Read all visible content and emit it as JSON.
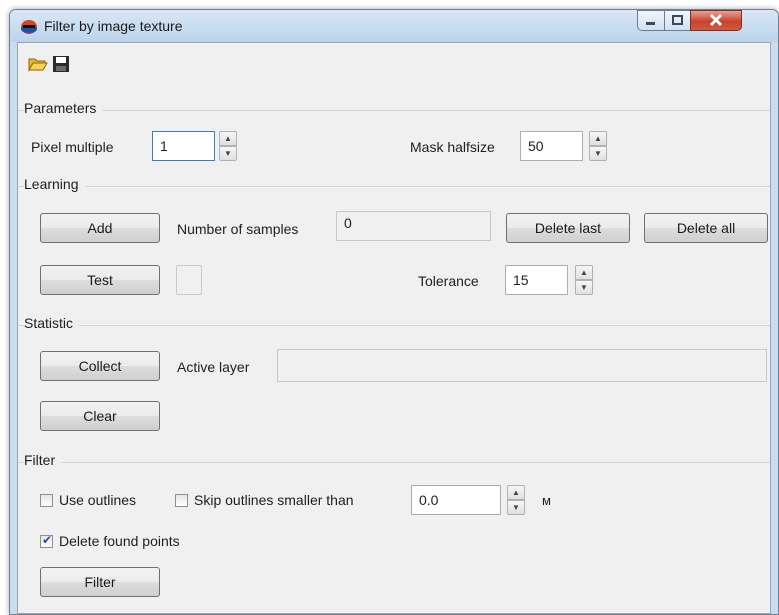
{
  "window": {
    "title": "Filter by image texture"
  },
  "toolbar": {
    "open": "folder-open-icon",
    "save": "save-icon"
  },
  "parameters": {
    "header": "Parameters",
    "pixel_multiple_label": "Pixel multiple",
    "pixel_multiple_value": "1",
    "mask_halfsize_label": "Mask halfsize",
    "mask_halfsize_value": "50"
  },
  "learning": {
    "header": "Learning",
    "add_label": "Add",
    "samples_label": "Number of samples",
    "samples_value": "0",
    "delete_last_label": "Delete last",
    "delete_all_label": "Delete all",
    "test_label": "Test",
    "tolerance_label": "Tolerance",
    "tolerance_value": "15"
  },
  "statistic": {
    "header": "Statistic",
    "collect_label": "Collect",
    "active_layer_label": "Active layer",
    "active_layer_value": "",
    "clear_label": "Clear"
  },
  "filter": {
    "header": "Filter",
    "use_outlines_label": "Use outlines",
    "use_outlines_checked": false,
    "skip_outlines_label": "Skip outlines smaller than",
    "skip_outlines_checked": false,
    "skip_value": "0.0",
    "unit": "м",
    "delete_found_label": "Delete found points",
    "delete_found_checked": true,
    "filter_label": "Filter"
  }
}
